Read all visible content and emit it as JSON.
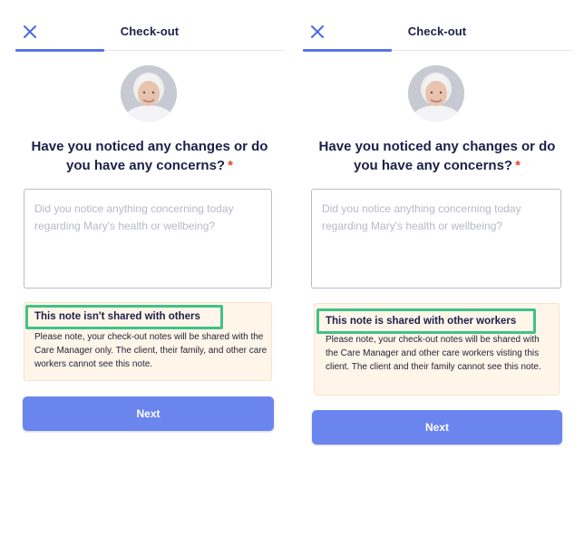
{
  "colors": {
    "accent": "#5a73e6",
    "button": "#6b85ee",
    "required": "#e2452f",
    "highlight": "#41c188",
    "notice_bg": "#fff5e9",
    "text": "#1c1f4a",
    "placeholder": "#b7bac6"
  },
  "icons": {
    "close": "close-icon",
    "avatar": "client-avatar"
  },
  "screens": [
    {
      "header": {
        "title": "Check-out",
        "close_icon": "close-icon",
        "progress": 0.33
      },
      "question": {
        "line1": "Have you noticed any changes or do",
        "line2": "you have any concerns?",
        "required_mark": "*"
      },
      "notes": {
        "placeholder": "Did you notice anything concerning today regarding Mary's health or wellbeing?"
      },
      "notice": {
        "title": "This note isn't shared with others",
        "body": "Please note, your check-out notes will be shared with the Care Manager only. The client, their family, and other care workers cannot see this note."
      },
      "next_label": "Next"
    },
    {
      "header": {
        "title": "Check-out",
        "close_icon": "close-icon",
        "progress": 0.33
      },
      "question": {
        "line1": "Have you noticed any changes or do",
        "line2": "you have any concerns?",
        "required_mark": "*"
      },
      "notes": {
        "placeholder": "Did you notice anything concerning today regarding Mary's health or wellbeing?"
      },
      "notice": {
        "title": "This note is shared with other workers",
        "body": "Please note, your check-out notes will be shared with the Care Manager and other care workers visting this client. The client and their family cannot see this note."
      },
      "next_label": "Next"
    }
  ]
}
